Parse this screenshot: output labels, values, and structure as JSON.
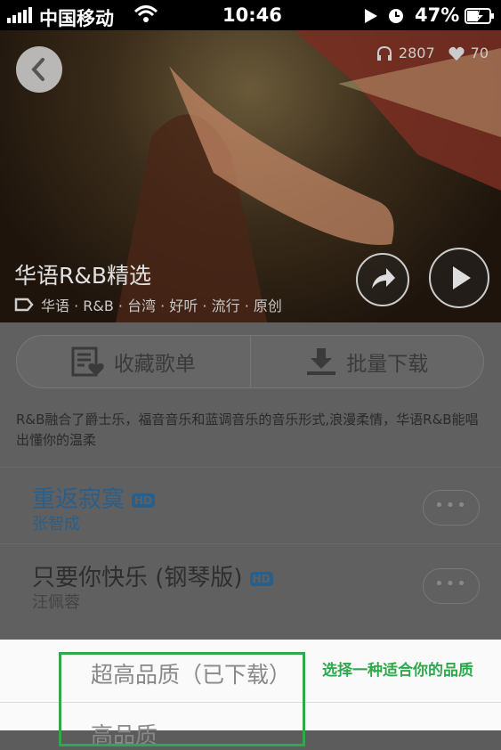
{
  "status_bar": {
    "carrier": "中国移动",
    "time": "10:46",
    "battery": "47%"
  },
  "hero": {
    "play_count": "2807",
    "like_count": "70",
    "title": "华语R&B精选",
    "tags": "华语 · R&B · 台湾 · 好听 · 流行 · 原创"
  },
  "actions": {
    "collect_label": "收藏歌单",
    "download_label": "批量下载"
  },
  "description": "R&B融合了爵士乐，福音音乐和蓝调音乐的音乐形式,浪漫柔情，华语R&B能唱出懂你的温柔",
  "songs": [
    {
      "title": "重返寂寞",
      "artist": "张智成",
      "badge": "HD"
    },
    {
      "title": "只要你快乐 (钢琴版)",
      "artist": "汪佩蓉",
      "badge": "HD"
    }
  ],
  "quality_sheet": {
    "option1": "超高品质（已下载）",
    "option2": "高品质"
  },
  "annotation": "选择一种适合你的品质",
  "colors": {
    "accent_blue": "#2a5f8a",
    "annotation_green": "#2fa84f"
  }
}
